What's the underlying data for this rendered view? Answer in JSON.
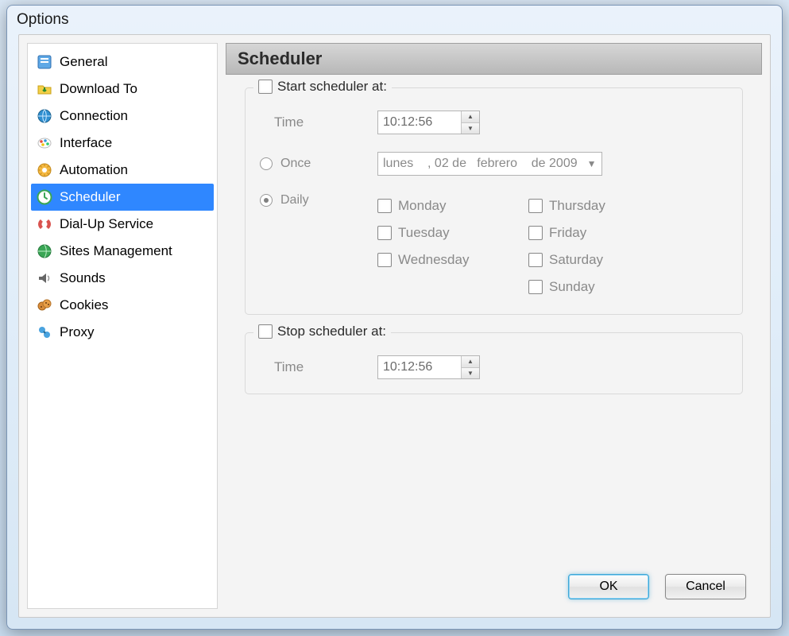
{
  "window": {
    "title": "Options"
  },
  "sidebar": {
    "items": [
      {
        "label": "General",
        "icon": "general-icon"
      },
      {
        "label": "Download To",
        "icon": "download-icon"
      },
      {
        "label": "Connection",
        "icon": "connection-icon"
      },
      {
        "label": "Interface",
        "icon": "interface-icon"
      },
      {
        "label": "Automation",
        "icon": "automation-icon"
      },
      {
        "label": "Scheduler",
        "icon": "scheduler-icon"
      },
      {
        "label": "Dial-Up Service",
        "icon": "dialup-icon"
      },
      {
        "label": "Sites Management",
        "icon": "sites-icon"
      },
      {
        "label": "Sounds",
        "icon": "sounds-icon"
      },
      {
        "label": "Cookies",
        "icon": "cookies-icon"
      },
      {
        "label": "Proxy",
        "icon": "proxy-icon"
      }
    ],
    "selected_index": 5
  },
  "panel": {
    "title": "Scheduler"
  },
  "start_group": {
    "title": "Start scheduler at:",
    "checked": false,
    "time_label": "Time",
    "time_value": "10:12:56",
    "mode": "Daily",
    "once_label": "Once",
    "once_date": "lunes    , 02 de   febrero    de 2009",
    "daily_label": "Daily",
    "days": [
      {
        "label": "Monday",
        "checked": false
      },
      {
        "label": "Tuesday",
        "checked": false
      },
      {
        "label": "Wednesday",
        "checked": false
      },
      {
        "label": "Thursday",
        "checked": false
      },
      {
        "label": "Friday",
        "checked": false
      },
      {
        "label": "Saturday",
        "checked": false
      },
      {
        "label": "Sunday",
        "checked": false
      }
    ]
  },
  "stop_group": {
    "title": "Stop scheduler at:",
    "checked": false,
    "time_label": "Time",
    "time_value": "10:12:56"
  },
  "footer": {
    "ok": "OK",
    "cancel": "Cancel"
  }
}
